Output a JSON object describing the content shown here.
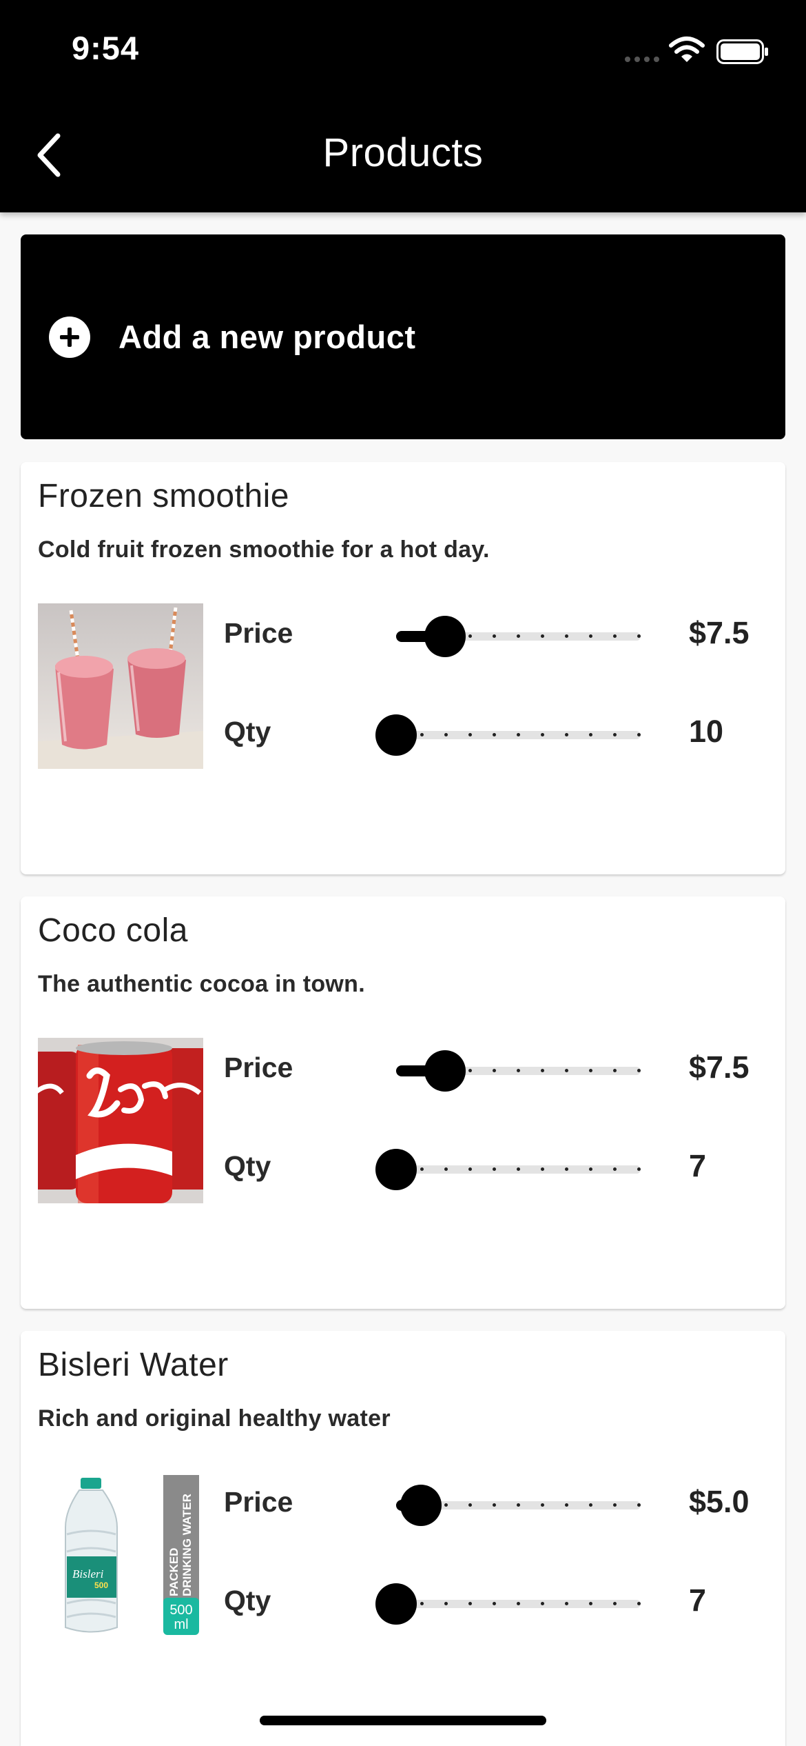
{
  "status_bar": {
    "time": "9:54"
  },
  "nav": {
    "title": "Products"
  },
  "add_product": {
    "label": "Add a new product"
  },
  "labels": {
    "price": "Price",
    "qty": "Qty"
  },
  "products": [
    {
      "name": "Frozen smoothie",
      "description": "Cold fruit frozen smoothie for a hot day.",
      "price": "$7.5",
      "qty": "10",
      "price_fraction": 0.2,
      "qty_fraction": 0.0
    },
    {
      "name": "Coco cola",
      "description": "The authentic cocoa in town.",
      "price": "$7.5",
      "qty": "7",
      "price_fraction": 0.2,
      "qty_fraction": 0.0
    },
    {
      "name": "Bisleri Water",
      "description": "Rich and original healthy water",
      "price": "$5.0",
      "qty": "7",
      "price_fraction": 0.1,
      "qty_fraction": 0.0,
      "label_lines": [
        "PACKED",
        "DRINKING WATER"
      ],
      "bottle_brand": "Bisleri",
      "bottle_size": "500",
      "badge_amount": "500",
      "badge_unit": "ml"
    }
  ]
}
